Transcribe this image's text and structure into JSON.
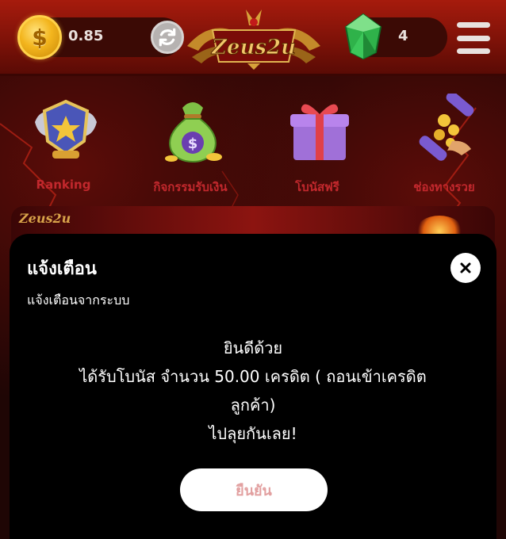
{
  "header": {
    "coin_symbol": "$",
    "balance": "0.85",
    "logo_text": "Zeus2u",
    "gems": "4"
  },
  "quick_menu": {
    "items": [
      {
        "label": "Ranking"
      },
      {
        "label": "กิจกรรมรับเงิน"
      },
      {
        "label": "โบนัสฟรี"
      },
      {
        "label": "ช่องทางรวย"
      }
    ]
  },
  "modal": {
    "title": "แจ้งเตือน",
    "subtitle": "แจ้งเตือนจากระบบ",
    "lines": [
      "ยินดีด้วย",
      "ได้รับโบนัส จำนวน 50.00 เครดิต ( ถอนเข้าเครดิต",
      "ลูกค้า)",
      "ไปลุยกันเลย!"
    ],
    "confirm_label": "ยืนยัน"
  }
}
